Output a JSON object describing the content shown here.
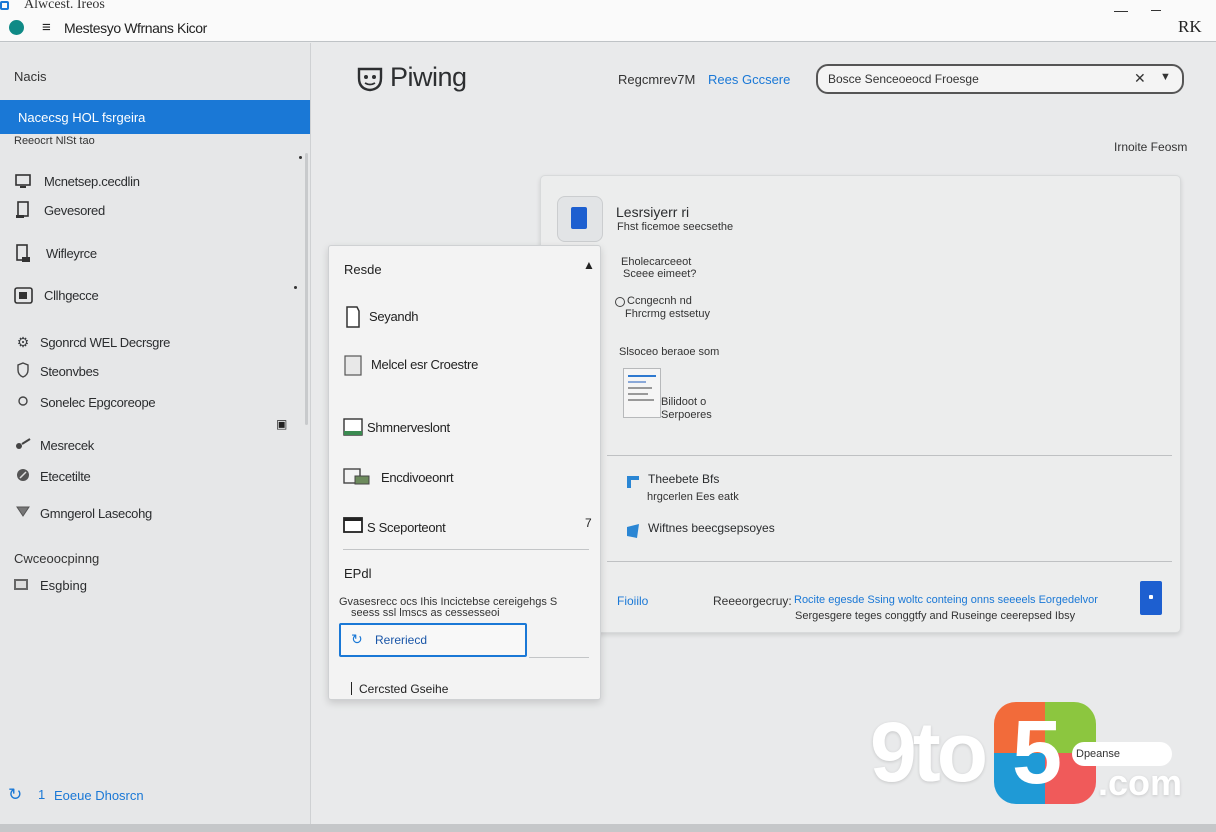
{
  "window": {
    "title": "Alwcest. Ireos",
    "menubar_title": "Mestesyo Wfrnans Kicor",
    "user_control": "RK"
  },
  "sidebar": {
    "heading": "Nacis",
    "selected_item": "Nacecsg HOL fsrgeira",
    "sub_label": "Reeocrt NlSt tao",
    "items": [
      {
        "label": "Mcnetsep.cecdlin",
        "icon": "monitor-icon"
      },
      {
        "label": "Gevesored",
        "icon": "document-icon"
      },
      {
        "label": "Wifleyrce",
        "icon": "file-icon"
      },
      {
        "label": "Cllhgecce",
        "icon": "tablet-icon"
      },
      {
        "label": "Sgonrcd WEL Decrsgre",
        "icon": "gear-icon"
      },
      {
        "label": "Steonvbes",
        "icon": "shield-icon"
      },
      {
        "label": "Sonelec Epgcoreope",
        "icon": "circle-icon"
      },
      {
        "label": "Mesrecek",
        "icon": "tools-icon"
      },
      {
        "label": "Etecetilte",
        "icon": "pencil-icon"
      },
      {
        "label": "Gmngerol Lasecohg",
        "icon": "heart-icon"
      }
    ],
    "group_heading": "Cwceoocpinng",
    "group_item": "Esgbing",
    "footer_number": "1",
    "footer_label": "Eoeue Dhosrcn"
  },
  "header": {
    "app_name": "Piwing",
    "user_label": "Regcmrev7M",
    "link_label": "Rees Gccsere",
    "search_value": "Bosce Senceoeocd Froesge",
    "profile_label": "Irnoite Feosm"
  },
  "card": {
    "title": "Lesrsiyerr ri",
    "subtitle": "Fhst ficemoe seecsethe",
    "option_heading": "Eholecarceeot",
    "option_sub": "Sceee eimeet?",
    "radio_label": "Ccngecnh nd",
    "radio_sub": "Fhrcrmg estsetuy",
    "section_label": "Slsoceo beraoe som",
    "doc_label1": "Bilidoot o",
    "doc_label2": "Serpoeres",
    "rows": [
      {
        "title": "Theebete Bfs",
        "sub": "hrgcerlen Ees eatk"
      },
      {
        "title": "Wiftnes beecgsepsoyes",
        "sub": ""
      }
    ],
    "footer_link": "Fioiilo",
    "footer_mid": "Reeeorgecruy:",
    "footer_blue": "Rocite egesde Ssing woltc conteing onns seeeels Eorgedelvor",
    "footer_grey": "Sergesgere teges conggtfy and Ruseinge ceerepsed Ibsy"
  },
  "panel": {
    "title": "Resde",
    "items": [
      {
        "label": "Seyandh",
        "icon": "page-icon"
      },
      {
        "label": "Melcel esr Croestre",
        "icon": "window-icon"
      },
      {
        "label": "Shmnerveslont",
        "icon": "display-icon"
      },
      {
        "label": "Encdivoeonrt",
        "icon": "camera-icon"
      },
      {
        "label": "S Sceporteont",
        "icon": "screen-icon"
      }
    ],
    "count": "7",
    "section_title": "EPdl",
    "desc_line1": "Gvasesrecc ocs Ihis Incictebse cereigehgs S",
    "desc_line2": "seess ssl lmscs as cessesseoi",
    "button_label": "Rereriecd",
    "footer_label": "Cercsted Gseihe"
  },
  "watermark": {
    "brand_left": "9to",
    "brand_five": "5",
    "brand_right": ".com",
    "pill_text": "Dpeanse"
  }
}
